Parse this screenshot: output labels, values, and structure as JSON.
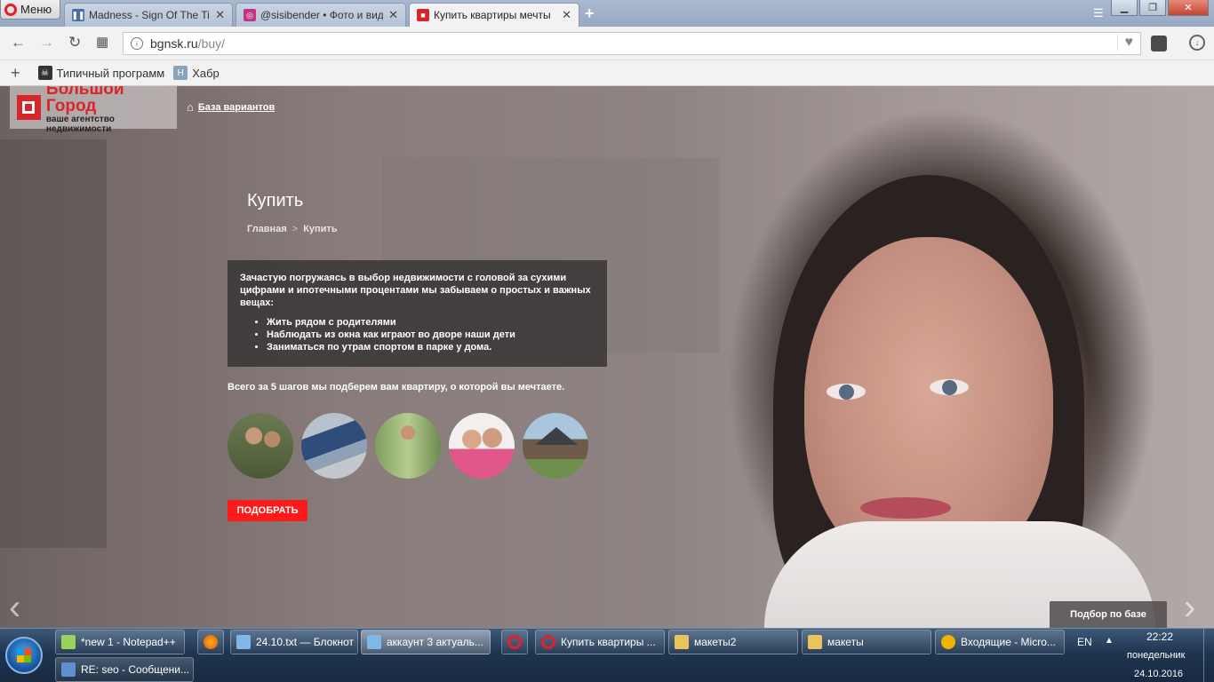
{
  "browser": {
    "menu_label": "Меню",
    "tabs": [
      {
        "title": "Madness - Sign Of The Times",
        "favicon": "pause-icon",
        "color": "#4a6fa5"
      },
      {
        "title": "@sisibender • Фото и видео",
        "favicon": "instagram-icon",
        "color": "#c13584"
      },
      {
        "title": "Купить квартиры мечты",
        "favicon": "bgnsk-icon",
        "color": "#d7262a",
        "active": true
      }
    ],
    "tab_close": "✕",
    "new_tab": "+",
    "url_host": "bgnsk.ru",
    "url_path": "/buy/",
    "bookmarks": [
      {
        "label": "Типичный программ",
        "icon": "skull-icon"
      },
      {
        "label": "Хабр",
        "icon": "habr-icon"
      }
    ]
  },
  "site": {
    "logo_line1": "Большой Город",
    "logo_line2": "ваше агентство недвижимости",
    "base_link": "База вариантов",
    "page_title": "Купить",
    "breadcrumb_home": "Главная",
    "breadcrumb_sep": ">",
    "breadcrumb_current": "Купить",
    "intro": "Зачастую погружаясь в выбор недвижимости с головой за сухими цифрами и ипотечными процентами мы забываем о простых и важных вещах:",
    "bullets": [
      "Жить рядом с родителями",
      "Наблюдать из окна как играют во дворе наши дети",
      "Заниматься по утрам спортом в парке у дома."
    ],
    "steps_text": "Всего за 5 шагов мы подберем вам квартиру, о которой вы мечтаете.",
    "pick_button": "ПОДОБРАТЬ",
    "pick_base": "Подбор по базе",
    "accent_color": "#ff1a1a"
  },
  "taskbar": {
    "items": [
      {
        "label": "*new 1 - Notepad++"
      },
      {
        "label": "24.10.txt — Блокнот"
      },
      {
        "label": "аккаунт 3 актуаль..."
      },
      {
        "label": "Купить квартиры ..."
      },
      {
        "label": "макеты2"
      },
      {
        "label": "макеты"
      },
      {
        "label": "Входящие - Micro..."
      },
      {
        "label": "RE: seo - Сообщени..."
      }
    ],
    "lang": "EN",
    "time": "22:22",
    "day": "понедельник",
    "date": "24.10.2016"
  }
}
